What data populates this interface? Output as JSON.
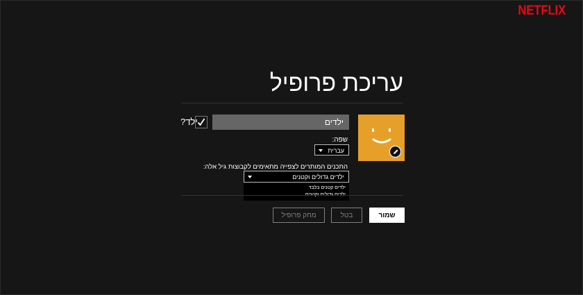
{
  "brand": {
    "logo_text": "NETFLIX",
    "logo_color": "#e50914"
  },
  "page": {
    "title": "עריכת פרופיל"
  },
  "profile": {
    "avatar_color": "#e6a02a",
    "avatar_edit_icon": "pencil-icon",
    "name_value": "ילדים",
    "kid_label": "ילד?",
    "kid_checked": true
  },
  "language": {
    "label": "שפה:",
    "selected": "עברית"
  },
  "maturity": {
    "label": "התכנים המותרים לצפייה מתאימים לקבוצות גיל אלה:",
    "selected": "ילדים גדולים וקטנים",
    "options": [
      "ילדים קטנים בלבד",
      "ילדים גדולים וקטנים"
    ]
  },
  "actions": {
    "save_label": "שמור",
    "cancel_label": "בטל",
    "delete_label": "מחק פרופיל"
  }
}
